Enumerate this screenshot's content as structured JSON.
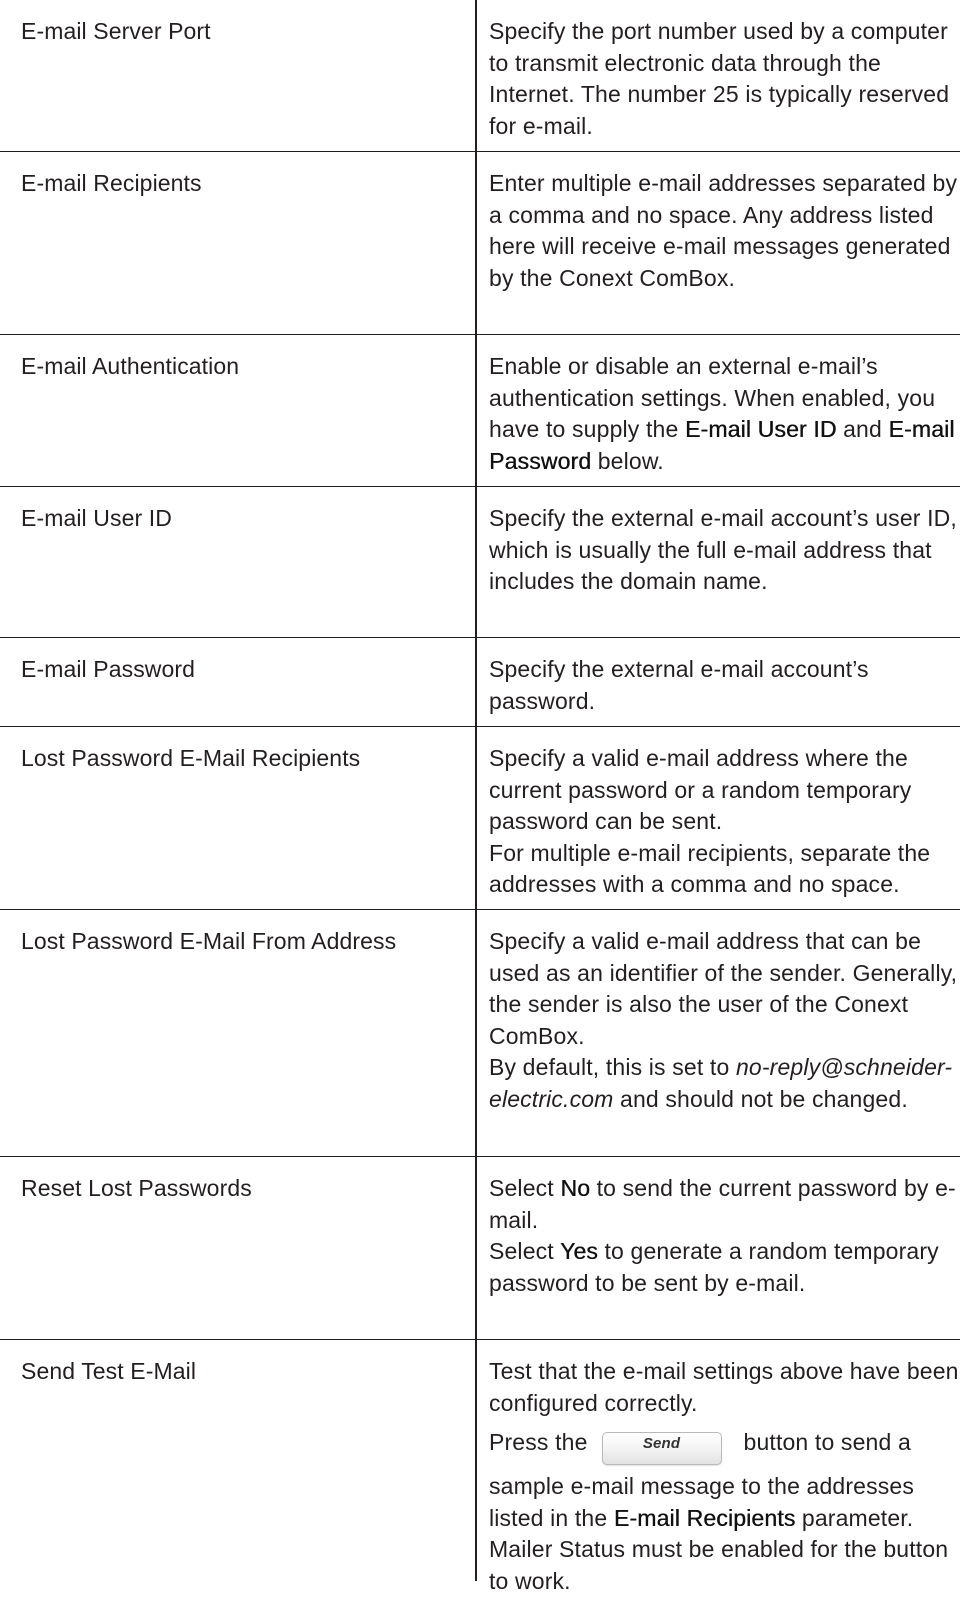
{
  "rows": [
    {
      "name": "E-mail Server Port",
      "desc": "Specify the port number used by a computer to transmit electronic data through the Internet. The number 25 is typically reserved for e-mail."
    },
    {
      "name": "E-mail Recipients",
      "desc": "Enter multiple e-mail addresses separated by a comma and no space. Any address listed here will receive e-mail messages generated by the Conext ComBox."
    },
    {
      "name": "E-mail Authentication",
      "desc_a": "Enable or disable an external e-mail’s authentication settings. When enabled, you have to supply the",
      "term_1": "E-mail User ID",
      "desc_b": "and",
      "term_2": "E-mail Password",
      "desc_c": "below."
    },
    {
      "name": "E-mail User ID",
      "desc": "Specify the external e-mail account’s user ID, which is usually the full e-mail address that includes the domain name."
    },
    {
      "name": "E-mail Password",
      "desc": "Specify the external e-mail account’s password."
    },
    {
      "name": "Lost Password E-Mail Recipients",
      "desc_1": "Specify a valid e-mail address where the current password or a random temporary password can be sent.",
      "desc_2": "For multiple e-mail recipients, separate the addresses with a comma and no space."
    },
    {
      "name": "Lost Password E-Mail From Address",
      "desc_1": "Specify a valid e-mail address that can be used as an identifier of the sender. Generally, the sender is also the user of the Conext ComBox.",
      "desc_2a": "By default, this is set to",
      "desc_2_italic": "no-reply@schneider-electric.com",
      "desc_2b": "and should not be changed."
    },
    {
      "name": "Reset Lost Passwords",
      "line1_a": "Select",
      "line1_term": "No",
      "line1_b": "to send the current password by e-mail.",
      "line2_a": "Select",
      "line2_term": "Yes",
      "line2_b": "to generate a random temporary password to be sent by e-mail."
    },
    {
      "name": "Send Test E-Mail",
      "desc_1": "Test that the e-mail settings above have been configured correctly.",
      "press_a": "Press the",
      "button_label": "Send",
      "press_b": "button to send a sample e-mail message to the addresses listed in the",
      "term": "E-mail Recipients",
      "press_c": "parameter. Mailer Status must be enabled for the button to work."
    }
  ]
}
